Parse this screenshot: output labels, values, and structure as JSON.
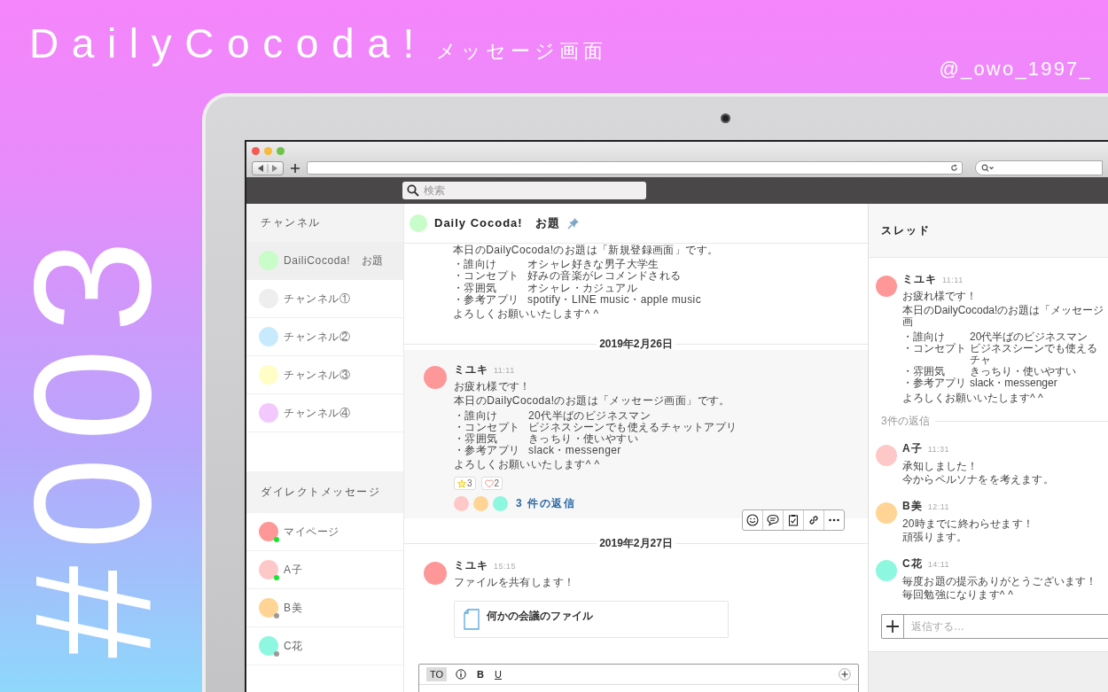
{
  "banner": {
    "title": "DailyCocoda!",
    "subtitle": "メッセージ画面",
    "handle": "@_owo_1997_",
    "number": "#003"
  },
  "app": {
    "search_placeholder": "検索",
    "sidebar": {
      "channels_heading": "チャンネル",
      "channels": [
        {
          "name": "DailiCocoda!　お題",
          "color": "#c8fcc8",
          "selected": true
        },
        {
          "name": "チャンネル①",
          "color": "#eeeeee",
          "selected": false
        },
        {
          "name": "チャンネル②",
          "color": "#c8eafe",
          "selected": false
        },
        {
          "name": "チャンネル③",
          "color": "#fefec6",
          "selected": false
        },
        {
          "name": "チャンネル④",
          "color": "#f3c8fe",
          "selected": false
        }
      ],
      "dm_heading": "ダイレクトメッセージ",
      "direct_messages": [
        {
          "name": "マイページ",
          "color": "#fe9898",
          "online": true
        },
        {
          "name": "A子",
          "color": "#ffc8c8",
          "online": true
        },
        {
          "name": "B美",
          "color": "#ffd494",
          "online": false
        },
        {
          "name": "C花",
          "color": "#8ef7e0",
          "online": false
        }
      ]
    },
    "channel_header": {
      "title": "Daily Cocoda!　お題",
      "color": "#c8fcc8"
    },
    "feed": [
      {
        "kind": "body",
        "paragraphs": [
          {
            "kind": "text",
            "text": "本日のDailyCocoda!のお題は「新規登録画面」です。"
          },
          {
            "kind": "list",
            "items": [
              {
                "label": "・誰向け",
                "value": "オシャレ好きな男子大学生"
              },
              {
                "label": "・コンセプト",
                "value": "好みの音楽がレコメンドされる"
              },
              {
                "label": "・雰囲気",
                "value": "オシャレ・カジュアル"
              },
              {
                "label": "・参考アプリ",
                "value": "spotify・LINE music・apple music"
              }
            ]
          },
          {
            "kind": "text",
            "text": "よろしくお願いいたします^ ^"
          }
        ]
      },
      {
        "kind": "date",
        "text": "2019年2月26日"
      },
      {
        "kind": "message",
        "highlighted": true,
        "author": "ミユキ",
        "time": "11:11",
        "color": "#fe9898",
        "paragraphs": [
          {
            "kind": "text",
            "text": "お疲れ様です！"
          },
          {
            "kind": "text",
            "text": "本日のDailyCocoda!のお題は「メッセージ画面」です。"
          },
          {
            "kind": "list",
            "items": [
              {
                "label": "・誰向け",
                "value": "20代半ばのビジネスマン"
              },
              {
                "label": "・コンセプト",
                "value": "ビジネスシーンでも使えるチャットアプリ"
              },
              {
                "label": "・雰囲気",
                "value": "きっちり・使いやすい"
              },
              {
                "label": "・参考アプリ",
                "value": "slack・messenger"
              }
            ]
          },
          {
            "kind": "text",
            "text": "よろしくお願いいたします^ ^"
          }
        ],
        "reactions": [
          {
            "kind": "star",
            "count": "3"
          },
          {
            "kind": "heart",
            "count": "2"
          }
        ],
        "replies": {
          "avatars": [
            {
              "color": "#ffc8c8"
            },
            {
              "color": "#ffd494"
            },
            {
              "color": "#8ef7e0"
            }
          ],
          "label": "3 件の返信"
        }
      },
      {
        "kind": "date",
        "text": "2019年2月27日"
      },
      {
        "kind": "message",
        "highlighted": false,
        "author": "ミユキ",
        "time": "15:15",
        "color": "#fe9898",
        "paragraphs": [
          {
            "kind": "text",
            "text": "ファイルを共有します！"
          }
        ],
        "file": "何かの会議のファイル"
      }
    ],
    "composer": {
      "buttons": [
        {
          "kind": "to",
          "label": "TO",
          "selected": true
        },
        {
          "kind": "info",
          "selected": false
        },
        {
          "kind": "bold",
          "label": "B",
          "selected": false
        },
        {
          "kind": "underline",
          "label": "U",
          "selected": false
        }
      ]
    },
    "thread": {
      "heading": "スレッド",
      "parent": {
        "author": "ミユキ",
        "time": "11:11",
        "color": "#fe9898",
        "paragraphs": [
          {
            "kind": "text",
            "text": "お疲れ様です！"
          },
          {
            "kind": "text",
            "text": "本日のDailyCocoda!のお題は「メッセージ画"
          },
          {
            "kind": "list",
            "items": [
              {
                "label": "・誰向け",
                "value": "20代半ばのビジネスマン"
              },
              {
                "label": "・コンセプト",
                "value": "ビジネスシーンでも使えるチャ"
              },
              {
                "label": "・雰囲気",
                "value": "きっちり・使いやすい"
              },
              {
                "label": "・参考アプリ",
                "value": "slack・messenger"
              }
            ]
          },
          {
            "kind": "text",
            "text": "よろしくお願いいたします^ ^"
          }
        ]
      },
      "reply_count": "3件の返信",
      "replies": [
        {
          "author": "A子",
          "time": "11:31",
          "color": "#ffc8c8",
          "lines": [
            "承知しました！",
            "今からペルソナをを考えます。"
          ]
        },
        {
          "author": "B美",
          "time": "12:11",
          "color": "#ffd494",
          "lines": [
            "20時までに終わらせます！",
            "頑張ります。"
          ]
        },
        {
          "author": "C花",
          "time": "14:11",
          "color": "#8ef7e0",
          "lines": [
            "毎度お題の提示ありがとうございます！",
            "毎回勉強になります^ ^"
          ]
        }
      ],
      "reply_placeholder": "返信する…"
    }
  }
}
